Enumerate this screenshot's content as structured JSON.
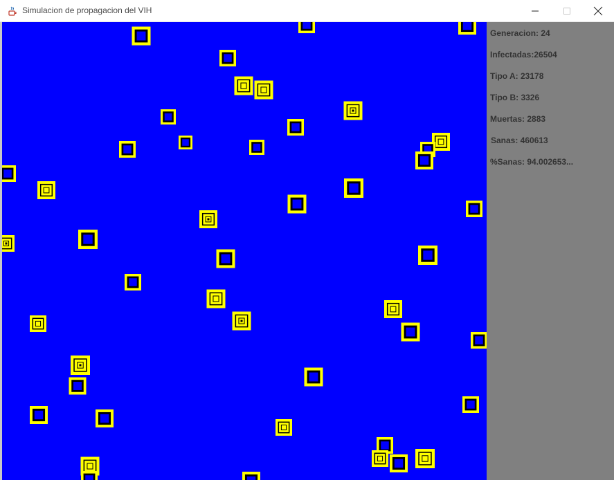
{
  "window": {
    "title": "Simulacion de propagacion del VIH",
    "icon": "java-coffee-cup-icon",
    "controls": [
      "minimize-icon",
      "maximize-icon",
      "close-icon"
    ]
  },
  "stats": {
    "generation": "Generacion: 24",
    "infected": "Infectadas:26504",
    "type_a": "Tipo A: 23178",
    "type_b": "Tipo B: 3326",
    "dead": "Muertas: 2883",
    "healthy": "Sanas: 460613",
    "healthy_pct": "%Sanas: 94.002653..."
  },
  "colors": {
    "grid_background": "#0000ff",
    "cell_outline": "#ffff00",
    "cell_inner": "#000000",
    "panel_background": "#808080",
    "stats_text": "#333333"
  }
}
